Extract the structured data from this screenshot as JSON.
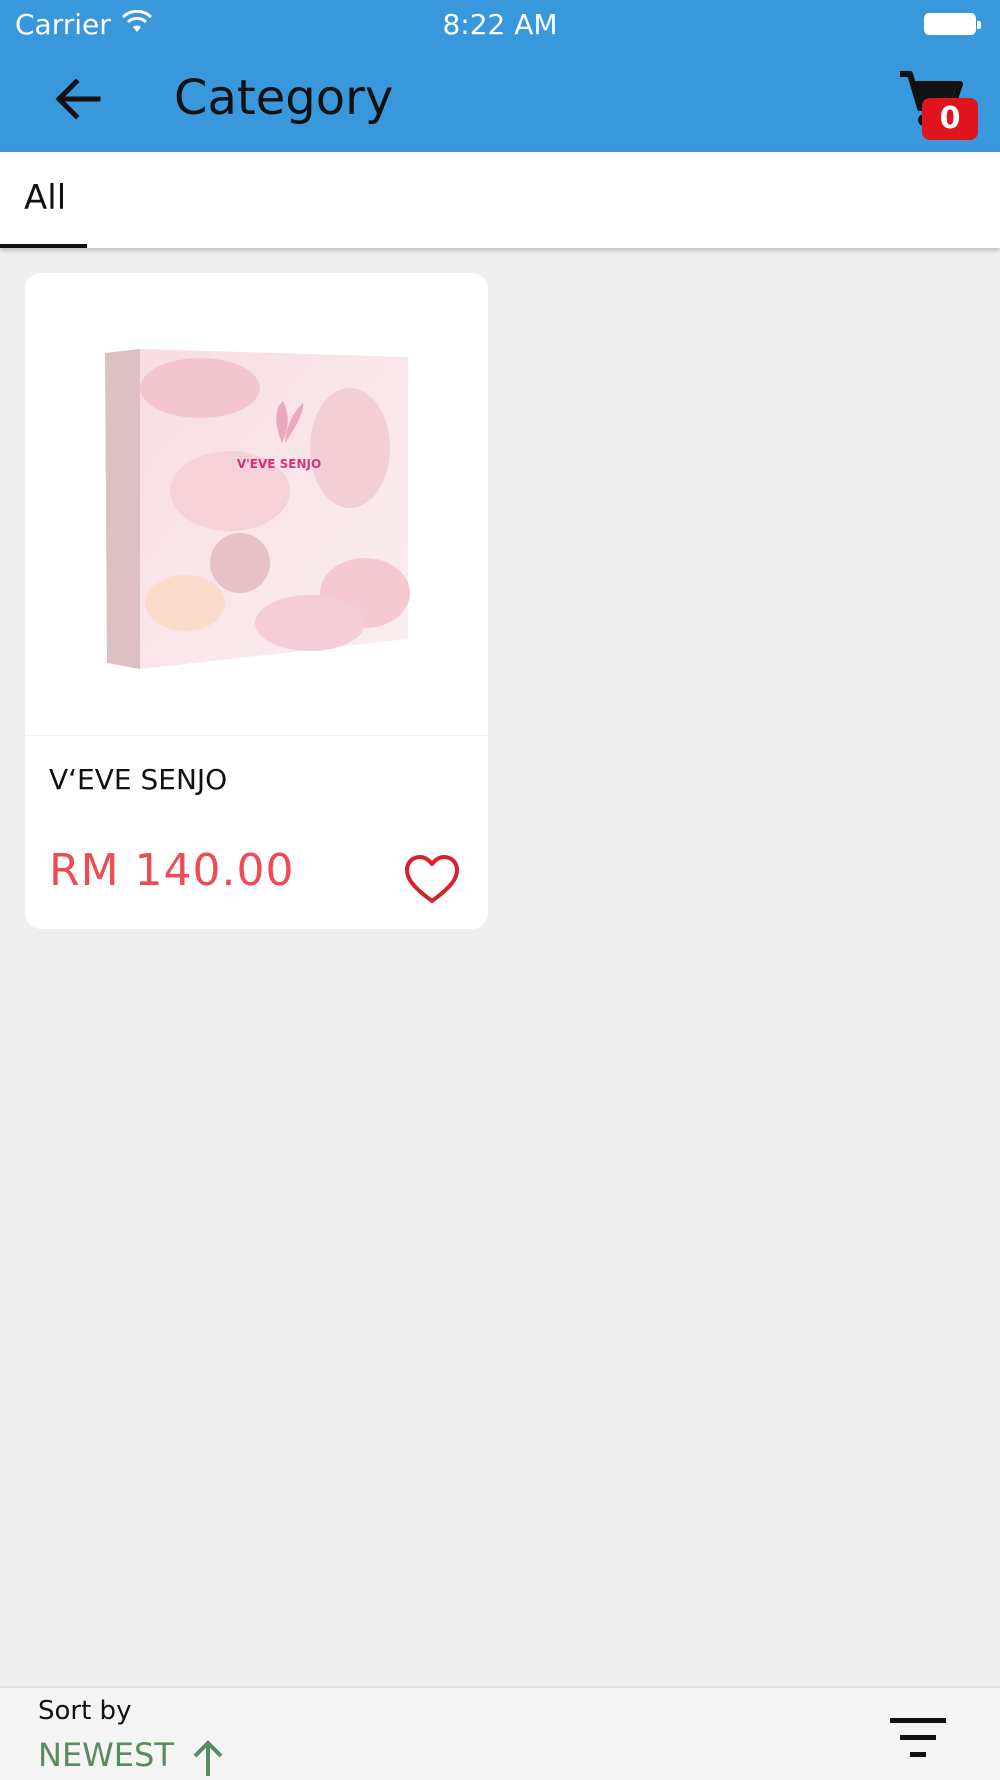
{
  "status_bar": {
    "carrier": "Carrier",
    "time": "8:22 AM"
  },
  "app_bar": {
    "title": "Category",
    "cart_count": "0",
    "color": "#3898db",
    "icons": [
      "arrow-back-icon",
      "cart-icon"
    ]
  },
  "tabs": [
    {
      "label": "All",
      "selected": true
    }
  ],
  "products": [
    {
      "name": "V‘EVE SENJO",
      "price": "RM 140.00",
      "image_logo_text": "V'EVE SENJO",
      "favorite": false
    }
  ],
  "sort_bar": {
    "label": "Sort by",
    "value": "NEWEST",
    "direction": "ascending",
    "icons": [
      "arrow-up-icon",
      "filter-icon"
    ]
  },
  "colors": {
    "price": "#ef4b57",
    "badge": "#e0141e",
    "sort_value": "#5a8a60",
    "heart": "#d9202a"
  }
}
